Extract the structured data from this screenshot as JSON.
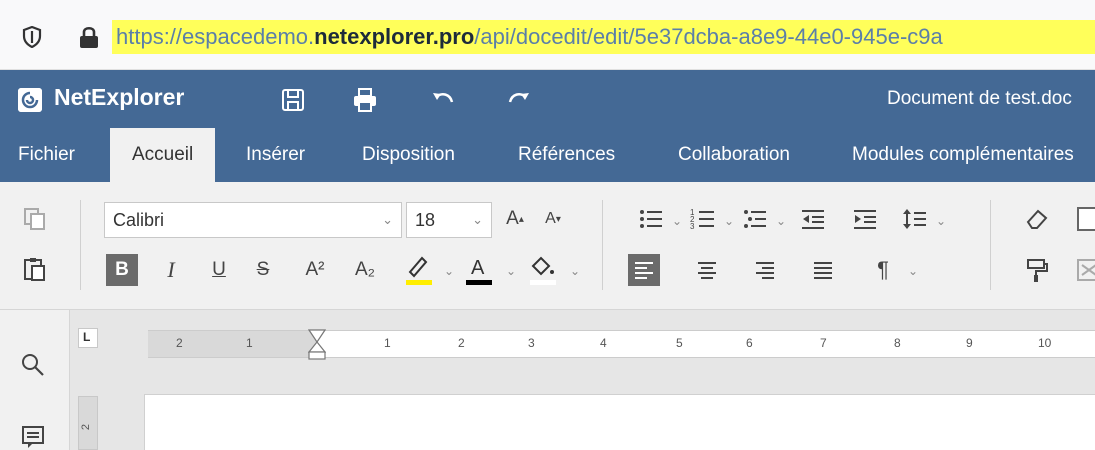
{
  "browser": {
    "url_prefix": "https://espacedemo.",
    "url_domain": "netexplorer.pro",
    "url_suffix": "/api/docedit/edit/5e37dcba-a8e9-44e0-945e-c9a"
  },
  "header": {
    "app_name": "NetExplorer",
    "document_title": "Document de test.doc"
  },
  "tabs": [
    {
      "label": "Fichier"
    },
    {
      "label": "Accueil"
    },
    {
      "label": "Insérer"
    },
    {
      "label": "Disposition"
    },
    {
      "label": "Références"
    },
    {
      "label": "Collaboration"
    },
    {
      "label": "Modules complémentaires"
    }
  ],
  "toolbar": {
    "font_family": "Calibri",
    "font_size": "18",
    "bold_label": "B",
    "italic_label": "I",
    "underline_label": "U",
    "strike_label": "S",
    "superscript_label": "A²",
    "subscript_label": "A₂",
    "grow_label": "A",
    "shrink_label": "A",
    "font_color_label": "A",
    "pilcrow_label": "¶",
    "highlight_color": "#ffee00",
    "font_color": "#000000"
  },
  "ruler": {
    "tab_marker": "L",
    "numbers": [
      "2",
      "1",
      "1",
      "2",
      "3",
      "4",
      "5",
      "6",
      "7",
      "8",
      "9",
      "10"
    ],
    "vertical_number": "2"
  }
}
